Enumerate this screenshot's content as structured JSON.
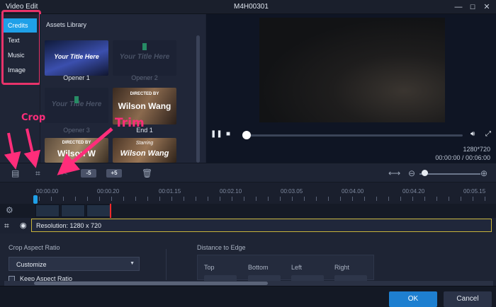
{
  "window": {
    "title": "Video Edit",
    "file": "M4H00301",
    "minimize": "—",
    "maximize": "☐",
    "close": "✕"
  },
  "categories": [
    {
      "label": "Credits",
      "active": true
    },
    {
      "label": "Text"
    },
    {
      "label": "Music"
    },
    {
      "label": "Image"
    }
  ],
  "assets": {
    "heading": "Assets Library",
    "items": [
      {
        "label": "Opener 1",
        "thumb_text": "Your Title Here"
      },
      {
        "label": "Opener 2",
        "thumb_text": "Your Title Here"
      },
      {
        "label": "Opener 3",
        "thumb_text": "Your Title Here"
      },
      {
        "label": "End 1",
        "thumb_small": "DIRECTED BY",
        "thumb_text": "Wilson Wang"
      },
      {
        "thumb_small": "DIRECTED BY",
        "thumb_text": "Wilson W"
      },
      {
        "thumb_small": "Starring",
        "thumb_text": "Wilson Wang"
      }
    ]
  },
  "preview": {
    "resolution": "1280*720",
    "time": "00:00:00 / 00:06:00",
    "progress": 0.0
  },
  "toolbar": {
    "speed_down": "-5",
    "speed_up": "+5"
  },
  "ruler": [
    "00:00.00",
    "00:00.20",
    "00:01.15",
    "00:02.10",
    "00:03.05",
    "00:04.00",
    "00:04.20",
    "00:05.15"
  ],
  "crop": {
    "resolution_label": "Resolution: 1280 x 720",
    "aspect_label": "Crop Aspect Ratio",
    "aspect_value": "Customize",
    "keep_aspect": "Keep Aspect Ratio",
    "distance_label": "Distance to Edge",
    "edges": [
      "Top",
      "Bottom",
      "Left",
      "Right"
    ]
  },
  "footer": {
    "ok": "OK",
    "cancel": "Cancel"
  },
  "annotations": {
    "crop": "Crop",
    "trim": "Trim"
  },
  "colors": {
    "accent": "#1fa0e8",
    "annotation": "#ff2d7a"
  }
}
